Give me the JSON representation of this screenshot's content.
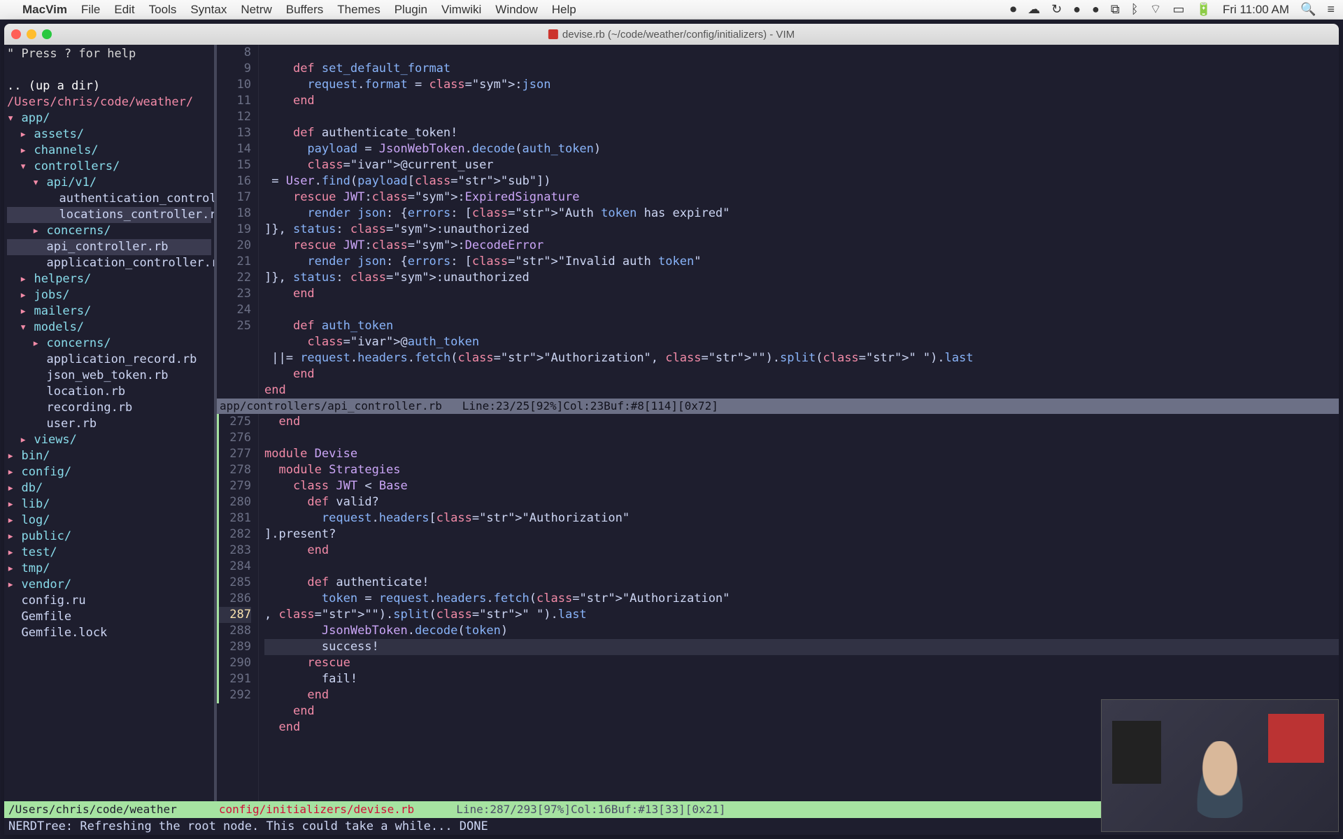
{
  "menubar": {
    "app": "MacVim",
    "items": [
      "File",
      "Edit",
      "Tools",
      "Syntax",
      "Netrw",
      "Buffers",
      "Themes",
      "Plugin",
      "Vimwiki",
      "Window",
      "Help"
    ],
    "clock": "Fri 11:00 AM"
  },
  "window": {
    "title": "devise.rb (~/code/weather/config/initializers) - VIM"
  },
  "nerdtree": {
    "help": "\" Press ? for help",
    "updir": ".. (up a dir)",
    "root": "/Users/chris/code/weather/",
    "tree": [
      {
        "ind": 0,
        "type": "dir",
        "open": true,
        "label": "app/"
      },
      {
        "ind": 1,
        "type": "dir",
        "open": false,
        "label": "assets/"
      },
      {
        "ind": 1,
        "type": "dir",
        "open": false,
        "label": "channels/"
      },
      {
        "ind": 1,
        "type": "dir",
        "open": true,
        "label": "controllers/"
      },
      {
        "ind": 2,
        "type": "dir",
        "open": true,
        "label": "api/v1/"
      },
      {
        "ind": 3,
        "type": "file",
        "label": "authentication_control>"
      },
      {
        "ind": 3,
        "type": "file",
        "label": "locations_controller.rb",
        "sel": true
      },
      {
        "ind": 2,
        "type": "dir",
        "open": false,
        "label": "concerns/"
      },
      {
        "ind": 2,
        "type": "file",
        "label": "api_controller.rb",
        "cur": true
      },
      {
        "ind": 2,
        "type": "file",
        "label": "application_controller.rb"
      },
      {
        "ind": 1,
        "type": "dir",
        "open": false,
        "label": "helpers/"
      },
      {
        "ind": 1,
        "type": "dir",
        "open": false,
        "label": "jobs/"
      },
      {
        "ind": 1,
        "type": "dir",
        "open": false,
        "label": "mailers/"
      },
      {
        "ind": 1,
        "type": "dir",
        "open": true,
        "label": "models/"
      },
      {
        "ind": 2,
        "type": "dir",
        "open": false,
        "label": "concerns/"
      },
      {
        "ind": 2,
        "type": "file",
        "label": "application_record.rb"
      },
      {
        "ind": 2,
        "type": "file",
        "label": "json_web_token.rb"
      },
      {
        "ind": 2,
        "type": "file",
        "label": "location.rb"
      },
      {
        "ind": 2,
        "type": "file",
        "label": "recording.rb"
      },
      {
        "ind": 2,
        "type": "file",
        "label": "user.rb"
      },
      {
        "ind": 1,
        "type": "dir",
        "open": false,
        "label": "views/"
      },
      {
        "ind": 0,
        "type": "dir",
        "open": false,
        "label": "bin/"
      },
      {
        "ind": 0,
        "type": "dir",
        "open": false,
        "label": "config/"
      },
      {
        "ind": 0,
        "type": "dir",
        "open": false,
        "label": "db/"
      },
      {
        "ind": 0,
        "type": "dir",
        "open": false,
        "label": "lib/"
      },
      {
        "ind": 0,
        "type": "dir",
        "open": false,
        "label": "log/"
      },
      {
        "ind": 0,
        "type": "dir",
        "open": false,
        "label": "public/"
      },
      {
        "ind": 0,
        "type": "dir",
        "open": false,
        "label": "test/"
      },
      {
        "ind": 0,
        "type": "dir",
        "open": false,
        "label": "tmp/"
      },
      {
        "ind": 0,
        "type": "dir",
        "open": false,
        "label": "vendor/"
      },
      {
        "ind": 0,
        "type": "file",
        "label": "config.ru"
      },
      {
        "ind": 0,
        "type": "file",
        "label": "Gemfile"
      },
      {
        "ind": 0,
        "type": "file",
        "label": "Gemfile.lock"
      }
    ]
  },
  "top_pane": {
    "start": 8,
    "lines": [
      "",
      "    def set_default_format",
      "      request.format = :json",
      "    end",
      "",
      "    def authenticate_token!",
      "      payload = JsonWebToken.decode(auth_token)",
      "      @current_user = User.find(payload[\"sub\"])",
      "    rescue JWT::ExpiredSignature",
      "      render json: {errors: [\"Auth token has expired\"]}, status: :unauthorized",
      "    rescue JWT::DecodeError",
      "      render json: {errors: [\"Invalid auth token\"]}, status: :unauthorized",
      "    end",
      "",
      "    def auth_token",
      "      @auth_token ||= request.headers.fetch(\"Authorization\", \"\").split(\" \").last",
      "    end",
      "end"
    ],
    "status": "app/controllers/api_controller.rb   Line:23/25[92%]Col:23Buf:#8[114][0x72]"
  },
  "bottom_pane": {
    "start": 275,
    "lines": [
      "  end",
      "",
      "module Devise",
      "  module Strategies",
      "    class JWT < Base",
      "      def valid?",
      "        request.headers[\"Authorization\"].present?",
      "      end",
      "",
      "      def authenticate!",
      "        token = request.headers.fetch(\"Authorization\", \"\").split(\" \").last",
      "        JsonWebToken.decode(token)",
      "        success!",
      "      rescue",
      "        fail!",
      "      end",
      "    end",
      "  end"
    ]
  },
  "bottom_status": {
    "path": "/Users/chris/code/weather",
    "file": "config/initializers/devise.rb",
    "info": "Line:287/293[97%]Col:16Buf:#13[33][0x21]"
  },
  "cmdline": "NERDTree: Refreshing the root node. This could take a while... DONE"
}
